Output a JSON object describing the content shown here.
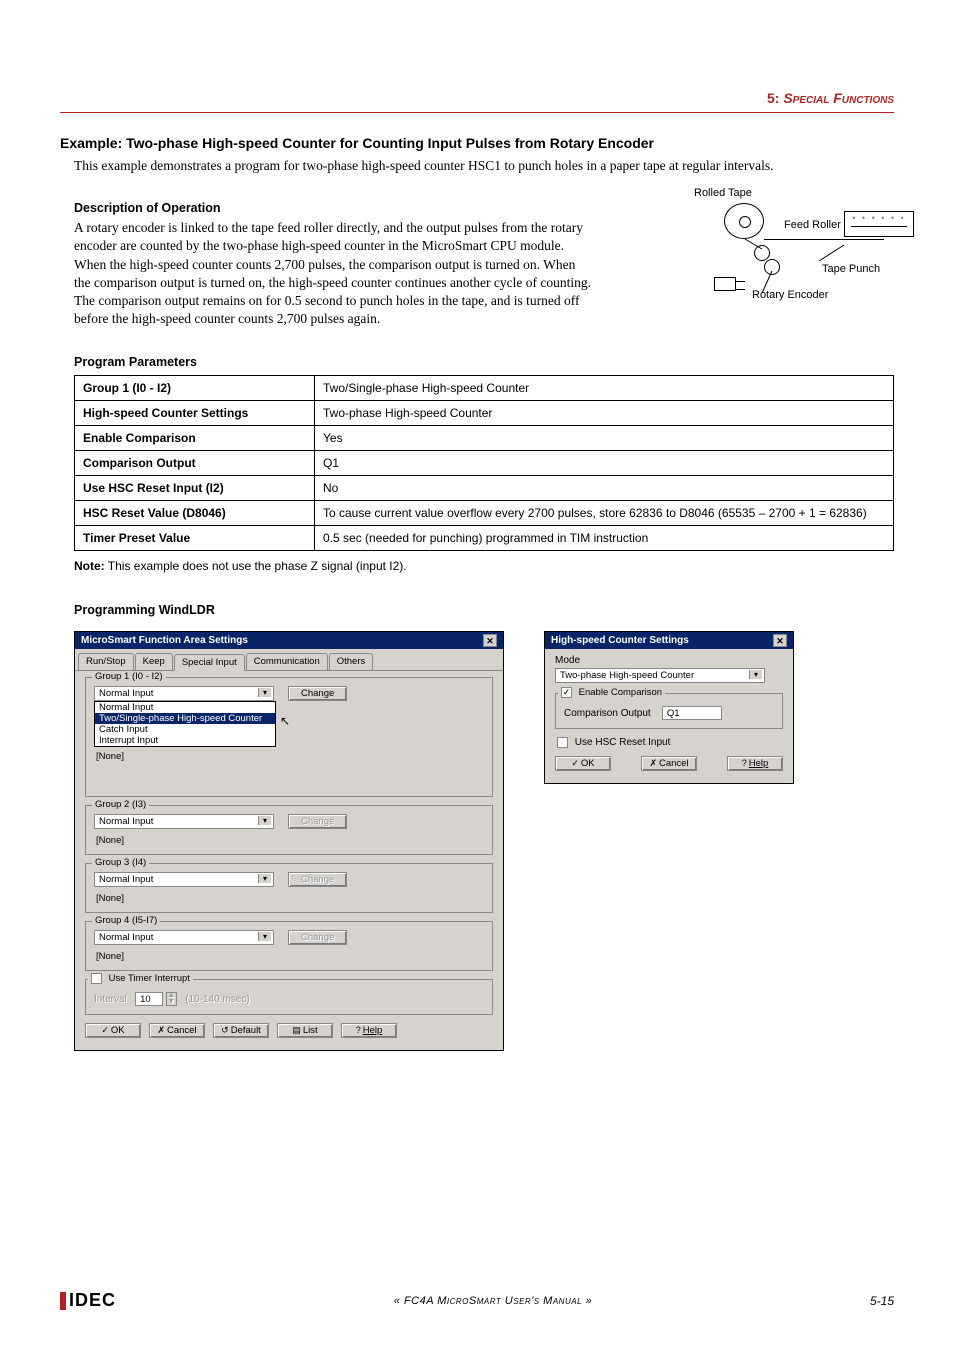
{
  "header": {
    "section_num": "5:",
    "section_title": "Special Functions"
  },
  "example_title": "Example: Two-phase High-speed Counter for Counting Input Pulses from Rotary Encoder",
  "intro": "This example demonstrates a program for two-phase high-speed counter HSC1 to punch holes in a paper tape at regular intervals.",
  "desc_head": "Description of Operation",
  "desc_body": "A rotary encoder is linked to the tape feed roller directly, and the output pulses from the rotary encoder are counted by the two-phase high-speed counter in the MicroSmart CPU module. When the high-speed counter counts 2,700 pulses, the comparison output is turned on. When the comparison output is turned on, the high-speed counter continues another cycle of counting. The comparison output remains on for 0.5 second to punch holes in the tape, and is turned off before the high-speed counter counts 2,700 pulses again.",
  "diagram": {
    "rolled_tape": "Rolled Tape",
    "feed_roller": "Feed Roller",
    "tape_punch": "Tape Punch",
    "rotary_encoder": "Rotary Encoder"
  },
  "params_head": "Program Parameters",
  "params": [
    {
      "k": "Group 1 (I0 - I2)",
      "v": "Two/Single-phase High-speed Counter"
    },
    {
      "k": "High-speed Counter Settings",
      "v": "Two-phase High-speed Counter"
    },
    {
      "k": "Enable Comparison",
      "v": "Yes"
    },
    {
      "k": "Comparison Output",
      "v": "Q1"
    },
    {
      "k": "Use HSC Reset Input (I2)",
      "v": "No"
    },
    {
      "k": "HSC Reset Value (D8046)",
      "v": "To cause current value overflow every 2700 pulses, store 62836 to D8046 (65535 – 2700 + 1 = 62836)"
    },
    {
      "k": "Timer Preset Value",
      "v": "0.5 sec (needed for punching) programmed in TIM instruction"
    }
  ],
  "note_label": "Note:",
  "note_text": " This example does not use the phase Z signal (input I2).",
  "prog_head": "Programming WindLDR",
  "dialog1": {
    "title": "MicroSmart Function Area Settings",
    "tabs": [
      "Run/Stop",
      "Keep",
      "Special Input",
      "Communication",
      "Others"
    ],
    "active_tab_index": 2,
    "group1_label": "Group 1 (I0 - I2)",
    "group2_label": "Group 2 (I3)",
    "group3_label": "Group 3 (I4)",
    "group4_label": "Group 4 (I5-I7)",
    "normal_input": "Normal Input",
    "dd_options": [
      "Normal Input",
      "Two/Single-phase High-speed Counter",
      "Catch Input",
      "Interrupt Input"
    ],
    "dd_selected_index": 1,
    "change": "Change",
    "none": "[None]",
    "use_timer_interrupt": "Use Timer Interrupt",
    "interval_label": "Interval",
    "interval_value": "10",
    "interval_unit": "(10-140 msec)",
    "btn_ok": "OK",
    "btn_cancel": "Cancel",
    "btn_default": "Default",
    "btn_list": "List",
    "btn_help": "Help"
  },
  "dialog2": {
    "title": "High-speed Counter Settings",
    "mode_label": "Mode",
    "mode_value": "Two-phase High-speed Counter",
    "enable_comparison": "Enable Comparison",
    "comparison_output_label": "Comparison Output",
    "comparison_output_value": "Q1",
    "use_hsc_reset": "Use HSC Reset Input",
    "btn_ok": "OK",
    "btn_cancel": "Cancel",
    "btn_help": "Help"
  },
  "footer": {
    "logo": "IDEC",
    "center": "« FC4A MicroSmart User's Manual »",
    "page": "5-15"
  }
}
